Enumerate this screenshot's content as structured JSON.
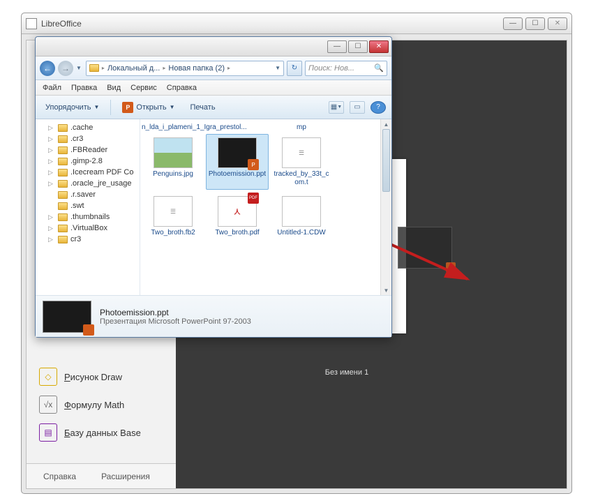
{
  "libreoffice": {
    "title": "LibreOffice",
    "win_buttons": {
      "min": "—",
      "max": "☐",
      "close": "✕"
    },
    "start_items": {
      "draw": "Рисунок Draw",
      "math": "Формулу Math",
      "base": "Базу данных Base"
    },
    "bottom": {
      "help": "Справка",
      "ext": "Расширения"
    },
    "thumb_label": "Без имени 1"
  },
  "explorer": {
    "win_buttons": {
      "min": "—",
      "max": "☐",
      "close": "✕"
    },
    "nav": {
      "back": "←",
      "fwd": "→",
      "segments": [
        "Локальный д...",
        "Новая папка (2)"
      ],
      "refresh": "↻",
      "search_placeholder": "Поиск: Нов...",
      "search_icon": "🔍"
    },
    "menu": [
      "Файл",
      "Правка",
      "Вид",
      "Сервис",
      "Справка"
    ],
    "toolbar": {
      "organize": "Упорядочить",
      "open": "Открыть",
      "print": "Печать",
      "help": "?"
    },
    "tree": [
      ".cache",
      ".cr3",
      ".FBReader",
      ".gimp-2.8",
      ".Icecream PDF Co",
      ".oracle_jre_usage",
      ".r.saver",
      ".swt",
      ".thumbnails",
      ".VirtualBox",
      "cr3"
    ],
    "partial_top": {
      "a": "n_lda_i_plameni_1_Igra_prestol...",
      "b": "mp"
    },
    "files": [
      {
        "name": "Penguins.jpg",
        "kind": "img"
      },
      {
        "name": "Photoemission.ppt",
        "kind": "ppt",
        "selected": true
      },
      {
        "name": "tracked_by_33t_com.t",
        "kind": "txt"
      },
      {
        "name": "Two_broth.fb2",
        "kind": "txt"
      },
      {
        "name": "Two_broth.pdf",
        "kind": "pdf"
      },
      {
        "name": "Untitled-1.CDW",
        "kind": "txt"
      }
    ],
    "details": {
      "filename": "Photoemission.ppt",
      "filetype": "Презентация Microsoft PowerPoint 97-2003"
    }
  }
}
